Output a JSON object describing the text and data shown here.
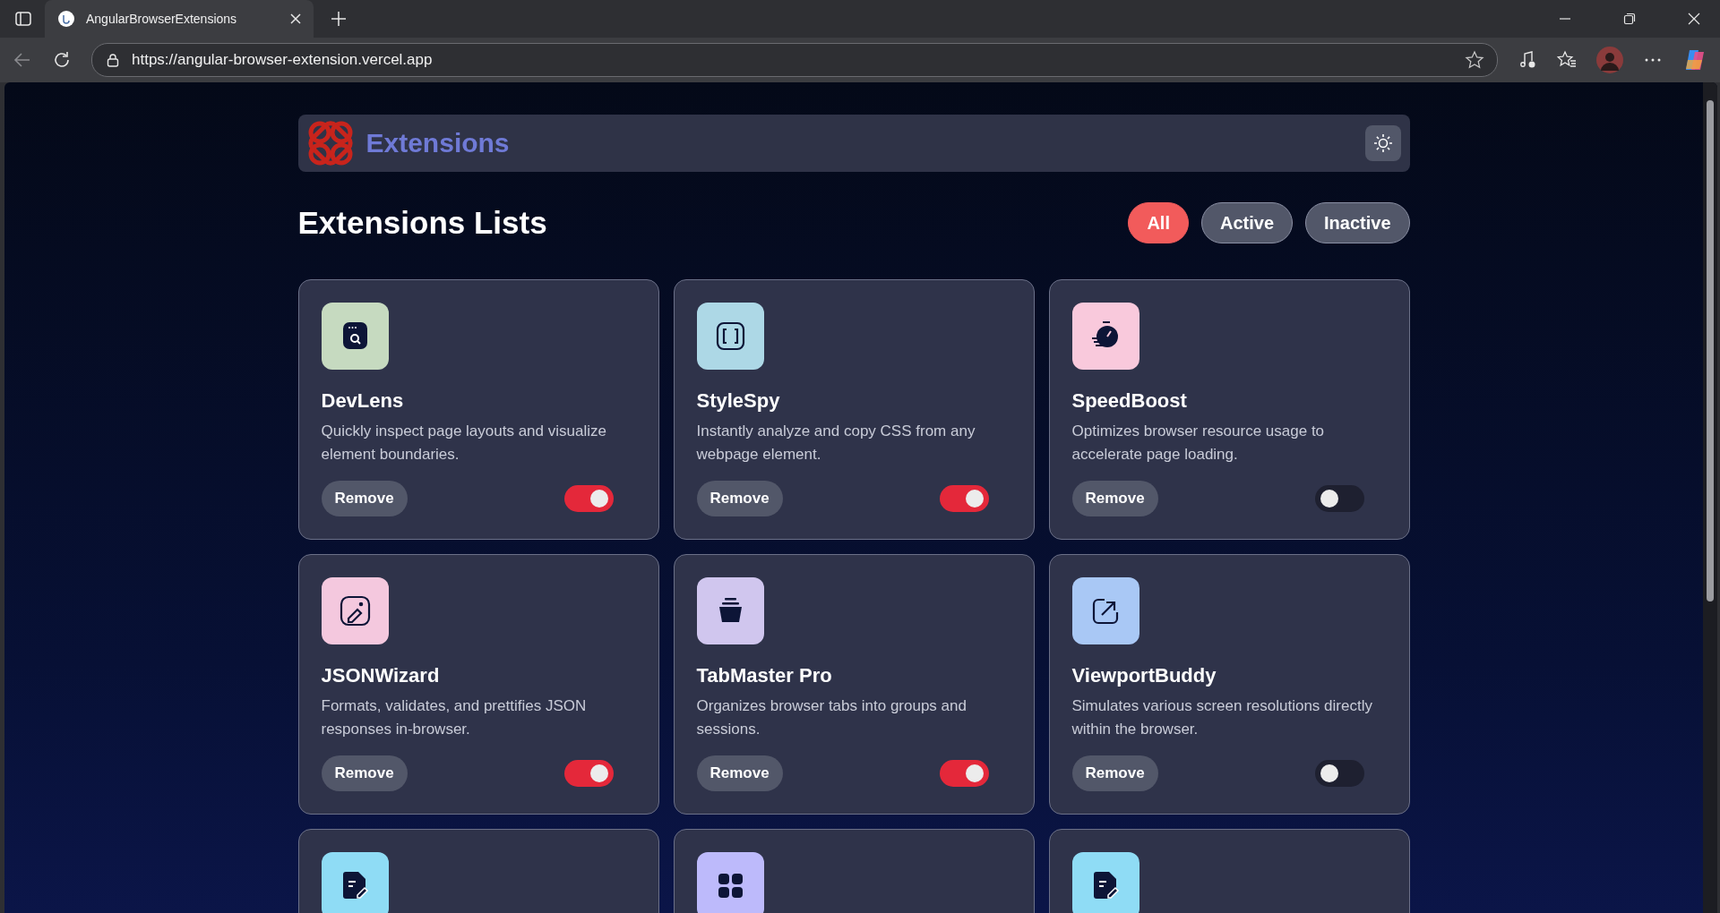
{
  "browser": {
    "tab_title": "AngularBrowserExtensions",
    "url": "https://angular-browser-extension.vercel.app"
  },
  "header": {
    "title": "Extensions"
  },
  "page_title": "Extensions Lists",
  "filters": [
    {
      "label": "All",
      "selected": true
    },
    {
      "label": "Active",
      "selected": false
    },
    {
      "label": "Inactive",
      "selected": false
    }
  ],
  "cards": [
    {
      "name": "DevLens",
      "description": "Quickly inspect page layouts and visualize element boundaries.",
      "color": "#c6dac0",
      "on": true,
      "button": "Remove"
    },
    {
      "name": "StyleSpy",
      "description": "Instantly analyze and copy CSS from any webpage element.",
      "color": "#add8e6",
      "on": true,
      "button": "Remove"
    },
    {
      "name": "SpeedBoost",
      "description": "Optimizes browser resource usage to accelerate page loading.",
      "color": "#f9c9dc",
      "on": false,
      "button": "Remove"
    },
    {
      "name": "JSONWizard",
      "description": "Formats, validates, and prettifies JSON responses in-browser.",
      "color": "#f4c8de",
      "on": true,
      "button": "Remove"
    },
    {
      "name": "TabMaster Pro",
      "description": "Organizes browser tabs into groups and sessions.",
      "color": "#d0c6ee",
      "on": true,
      "button": "Remove"
    },
    {
      "name": "ViewportBuddy",
      "description": "Simulates various screen resolutions directly within the browser.",
      "color": "#a9c8f5",
      "on": false,
      "button": "Remove"
    },
    {
      "color": "#8fdcf5"
    },
    {
      "color": "#bdbafb"
    },
    {
      "color": "#8fdcf5"
    }
  ]
}
